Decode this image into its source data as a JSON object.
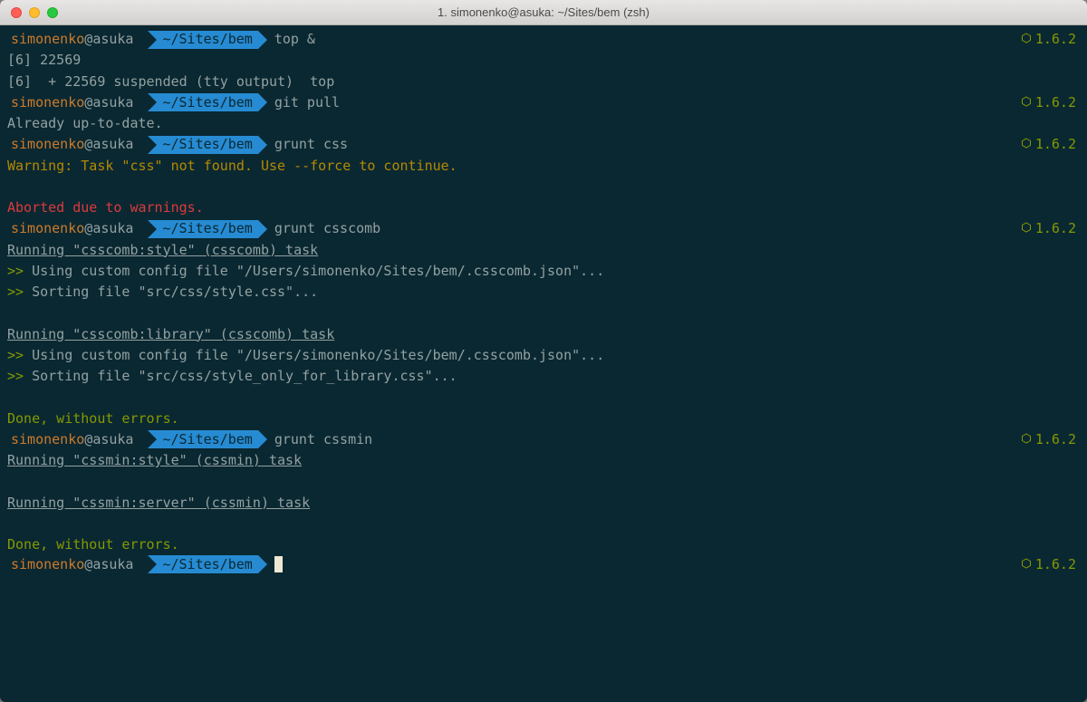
{
  "window": {
    "title": "1. simonenko@asuka: ~/Sites/bem (zsh)"
  },
  "prompt": {
    "user": "simonenko",
    "at": "@",
    "host": "asuka",
    "path": "~/Sites/bem",
    "version": "1.6.2"
  },
  "session": [
    {
      "type": "prompt",
      "cmd": "top &"
    },
    {
      "type": "out",
      "text": "[6] 22569"
    },
    {
      "type": "out",
      "text": "[6]  + 22569 suspended (tty output)  top"
    },
    {
      "type": "prompt",
      "cmd": "git pull"
    },
    {
      "type": "out",
      "text": "Already up-to-date."
    },
    {
      "type": "prompt",
      "cmd": "grunt css"
    },
    {
      "type": "out",
      "class": "yellow",
      "text": "Warning: Task \"css\" not found. Use --force to continue."
    },
    {
      "type": "blank"
    },
    {
      "type": "out",
      "class": "red",
      "text": "Aborted due to warnings."
    },
    {
      "type": "prompt",
      "cmd": "grunt csscomb"
    },
    {
      "type": "out",
      "class": "underline",
      "text": "Running \"csscomb:style\" (csscomb) task"
    },
    {
      "type": "out-arrow",
      "text": "Using custom config file \"/Users/simonenko/Sites/bem/.csscomb.json\"..."
    },
    {
      "type": "out-arrow",
      "text": "Sorting file \"src/css/style.css\"..."
    },
    {
      "type": "blank"
    },
    {
      "type": "out",
      "class": "underline",
      "text": "Running \"csscomb:library\" (csscomb) task"
    },
    {
      "type": "out-arrow",
      "text": "Using custom config file \"/Users/simonenko/Sites/bem/.csscomb.json\"..."
    },
    {
      "type": "out-arrow",
      "text": "Sorting file \"src/css/style_only_for_library.css\"..."
    },
    {
      "type": "blank"
    },
    {
      "type": "out",
      "class": "green",
      "text": "Done, without errors."
    },
    {
      "type": "prompt",
      "cmd": "grunt cssmin"
    },
    {
      "type": "out",
      "class": "underline",
      "text": "Running \"cssmin:style\" (cssmin) task"
    },
    {
      "type": "blank"
    },
    {
      "type": "out",
      "class": "underline",
      "text": "Running \"cssmin:server\" (cssmin) task"
    },
    {
      "type": "blank"
    },
    {
      "type": "out",
      "class": "green",
      "text": "Done, without errors."
    },
    {
      "type": "prompt-cursor"
    }
  ],
  "arrow_prefix": ">>"
}
